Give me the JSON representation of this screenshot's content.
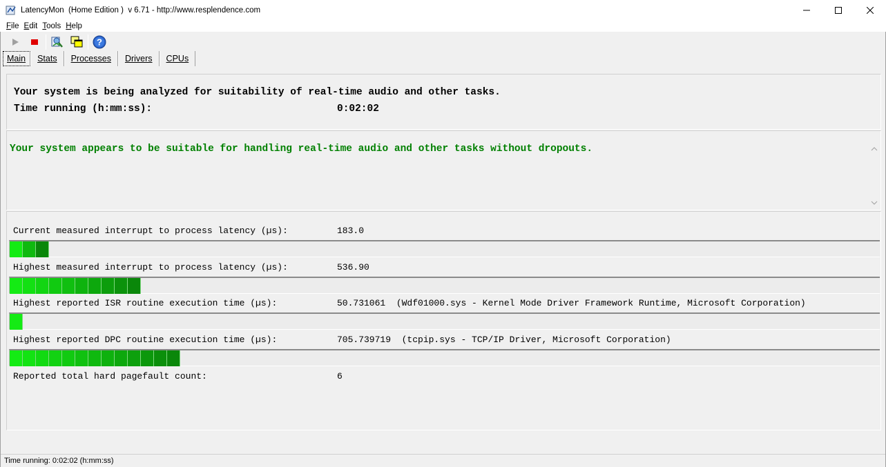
{
  "window": {
    "title": "LatencyMon  (Home Edition )  v 6.71 - http://www.resplendence.com"
  },
  "menu": {
    "items": [
      {
        "label": "File",
        "accel": "F",
        "rest": "ile"
      },
      {
        "label": "Edit",
        "accel": "E",
        "rest": "dit"
      },
      {
        "label": "Tools",
        "accel": "T",
        "rest": "ools"
      },
      {
        "label": "Help",
        "accel": "H",
        "rest": "elp"
      }
    ]
  },
  "toolbar": {
    "icons": [
      "play-icon",
      "stop-icon",
      "analyze-icon",
      "windows-icon",
      "help-icon"
    ]
  },
  "tabs": [
    {
      "label": "Main",
      "active": true
    },
    {
      "label": "Stats",
      "active": false
    },
    {
      "label": "Processes",
      "active": false
    },
    {
      "label": "Drivers",
      "active": false
    },
    {
      "label": "CPUs",
      "active": false
    }
  ],
  "summary": {
    "analyzing": "Your system is being analyzed for suitability of real-time audio and other tasks.",
    "time_label": "Time running (h:mm:ss):",
    "time_value": "0:02:02"
  },
  "verdict": {
    "message": "Your system appears to be suitable for handling real-time audio and other tasks without dropouts.",
    "color": "#008000"
  },
  "metrics": [
    {
      "label": "Current measured interrupt to process latency (µs):",
      "value": "183.0",
      "detail": "",
      "segments": 3
    },
    {
      "label": "Highest measured interrupt to process latency (µs):",
      "value": "536.90",
      "detail": "",
      "segments": 10
    },
    {
      "label": "Highest reported ISR routine execution time (µs):",
      "value": "50.731061",
      "detail": "(Wdf01000.sys - Kernel Mode Driver Framework Runtime, Microsoft Corporation)",
      "segments": 1
    },
    {
      "label": "Highest reported DPC routine execution time (µs):",
      "value": "705.739719",
      "detail": "(tcpip.sys - TCP/IP Driver, Microsoft Corporation)",
      "segments": 13
    },
    {
      "label": "Reported total hard pagefault count:",
      "value": "6",
      "detail": "",
      "segments": 0
    }
  ],
  "status": {
    "text": "Time running: 0:02:02  (h:mm:ss)"
  }
}
